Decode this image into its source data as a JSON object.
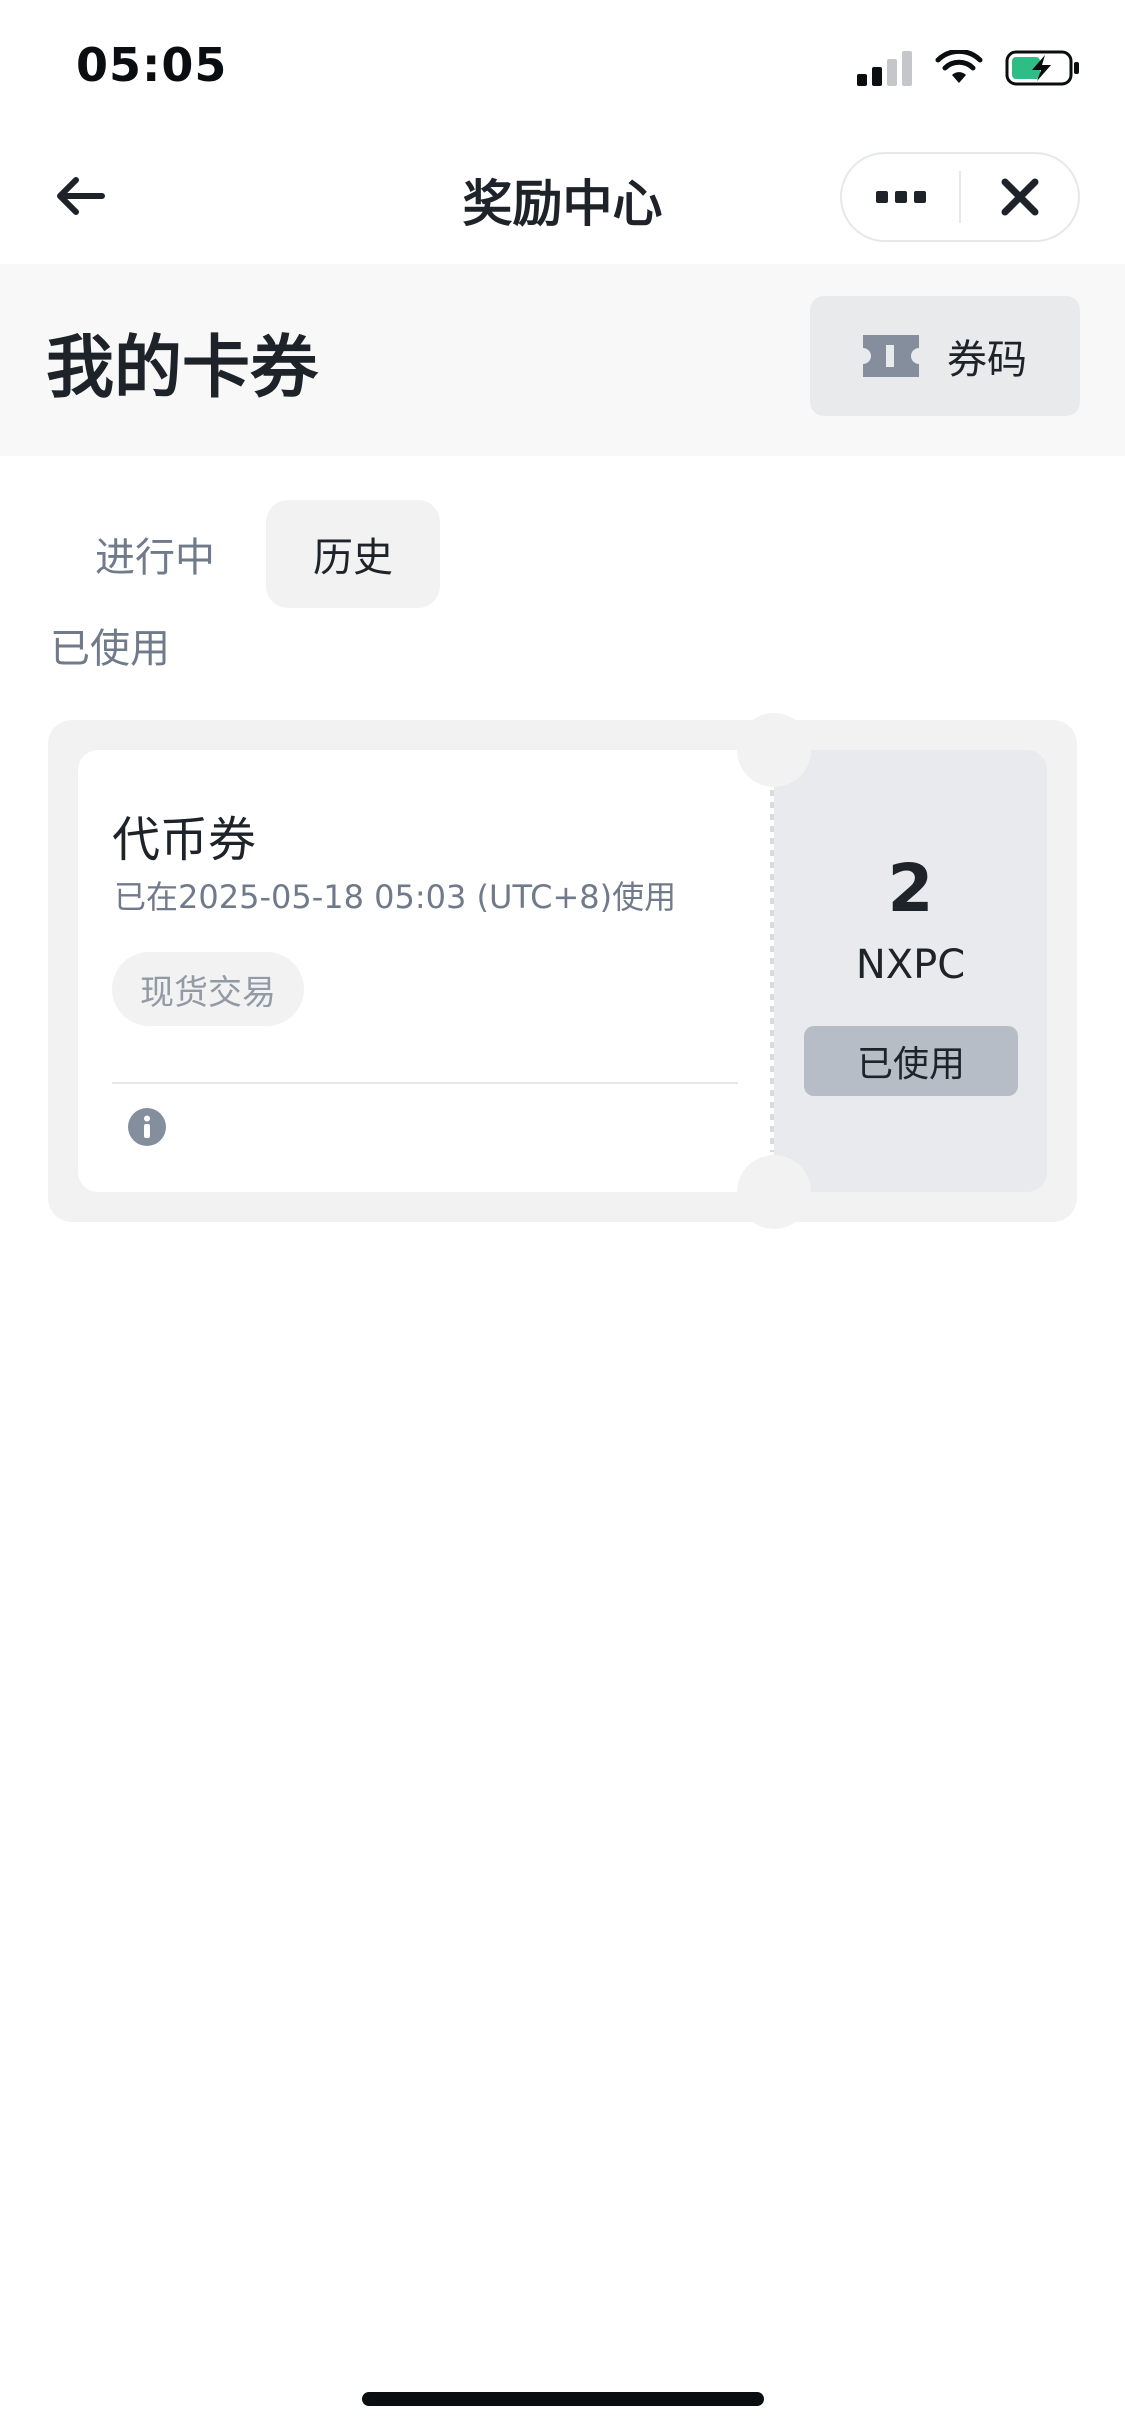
{
  "status_bar": {
    "time": "05:05",
    "icons": [
      "signal-icon",
      "wifi-icon",
      "battery-charging-icon"
    ]
  },
  "nav": {
    "title": "奖励中心",
    "back_icon": "arrow-left-icon",
    "more_icon": "more-dots-icon",
    "close_icon": "close-icon"
  },
  "header": {
    "title": "我的卡券",
    "code_button": {
      "label": "券码",
      "icon": "ticket-icon"
    }
  },
  "tabs": [
    {
      "label": "进行中",
      "active": false
    },
    {
      "label": "历史",
      "active": true
    }
  ],
  "section": {
    "label": "已使用"
  },
  "vouchers": [
    {
      "name": "代币券",
      "used_time": "已在2025-05-18 05:03 (UTC+8)使用",
      "tag": "现货交易",
      "amount": "2",
      "unit": "NXPC",
      "status": "已使用",
      "info_icon": "info-icon"
    }
  ],
  "colors": {
    "text_primary": "#1e2329",
    "text_secondary": "#707a8a",
    "card_bg": "#f2f2f2",
    "ticket_right_bg": "#e9eaed",
    "badge_bg": "#b7bdc6",
    "battery_green": "#2ebd85"
  }
}
